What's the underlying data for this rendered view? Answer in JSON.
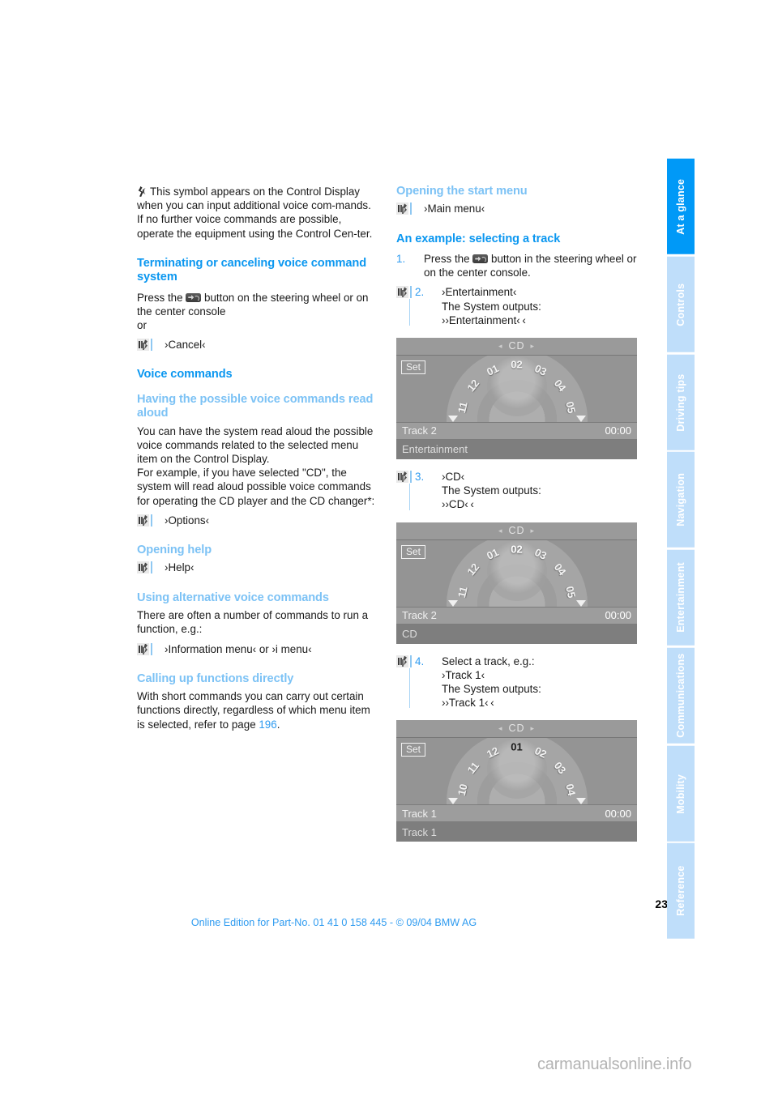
{
  "document": {
    "page_number": "23",
    "footer_text": "Online Edition for Part-No. 01 41 0 158 445 - © 09/04 BMW AG",
    "watermark": "carmanualsonline.info"
  },
  "tabs": [
    {
      "label": "At a glance",
      "active": true
    },
    {
      "label": "Controls",
      "active": false
    },
    {
      "label": "Driving tips",
      "active": false
    },
    {
      "label": "Navigation",
      "active": false
    },
    {
      "label": "Entertainment",
      "active": false
    },
    {
      "label": "Communications",
      "active": false
    },
    {
      "label": "Mobility",
      "active": false
    },
    {
      "label": "Reference",
      "active": false
    }
  ],
  "colors": {
    "heading_blue": "#0b97f0",
    "subheading_blue": "#7cc2f5",
    "tab_active": "#0099f7",
    "tab_inactive": "#bfdefa",
    "link": "#2e9bf0"
  },
  "left_column": {
    "intro_symbol_note": "This symbol appears on the Control Display when you can input additional voice com-mands.",
    "intro_line2": "If no further voice commands are possible, operate the equipment using the Control Cen-ter.",
    "terminating_heading": "Terminating or canceling voice command system",
    "terminating_body_a": "Press the ",
    "terminating_body_b": " button on the steering wheel or on the center console",
    "or_word": "or",
    "cancel_command": "›Cancel‹",
    "voice_commands_heading": "Voice commands",
    "read_aloud_heading": "Having the possible voice commands read aloud",
    "read_aloud_body": "You can have the system read aloud the possible voice commands related to the selected menu item on the Control Display.",
    "read_aloud_body2": "For example, if you have selected \"CD\", the system will read aloud possible voice commands for operating the CD player and the CD changer*:",
    "options_command": "›Options‹",
    "opening_help_heading": "Opening help",
    "help_command": "›Help‹",
    "alternative_heading": "Using alternative voice commands",
    "alternative_body": "There are often a number of commands to run a function, e.g.:",
    "alternative_command": "›Information menu‹  or ›i menu‹",
    "direct_heading": "Calling up functions directly",
    "direct_body_a": "With short commands you can carry out certain functions directly, regardless of which menu item is selected, refer to page ",
    "direct_page_ref": "196",
    "direct_body_b": "."
  },
  "right_column": {
    "start_menu_heading": "Opening the start menu",
    "main_menu_command": "›Main menu‹",
    "example_heading": "An example: selecting a track",
    "steps": [
      {
        "number": "1.",
        "text_a": "Press the ",
        "text_b": " button in the steering wheel or on the center console."
      },
      {
        "number": "2.",
        "command": "›Entertainment‹",
        "outputs_label": "The System outputs:",
        "output": "››Entertainment‹ ‹"
      },
      {
        "number": "3.",
        "command": "›CD‹",
        "outputs_label": "The System outputs:",
        "output": "››CD‹ ‹"
      },
      {
        "number": "4.",
        "lead": "Select a track, e.g.:",
        "command": "›Track 1‹",
        "outputs_label": "The System outputs:",
        "output": "››Track 1‹ ‹"
      }
    ],
    "displays": [
      {
        "title": "CD",
        "set_label": "Set",
        "track_label": "Track 2",
        "time": "00:00",
        "status": "Entertainment",
        "ticks": [
          "11",
          "12",
          "01",
          "02",
          "03",
          "04",
          "05"
        ],
        "selected": null,
        "selected_style": "none"
      },
      {
        "title": "CD",
        "set_label": "Set",
        "track_label": "Track 2",
        "time": "00:00",
        "status": "CD",
        "ticks": [
          "11",
          "12",
          "01",
          "02",
          "03",
          "04",
          "05"
        ],
        "selected": "02",
        "selected_style": "white"
      },
      {
        "title": "CD",
        "set_label": "Set",
        "track_label": "Track 1",
        "time": "00:00",
        "status": "Track 1",
        "ticks": [
          "10",
          "11",
          "12",
          "01",
          "02",
          "03",
          "04"
        ],
        "selected": "01",
        "selected_style": "dark"
      }
    ],
    "nav_arrow_left": "◂",
    "nav_arrow_right": "▸"
  }
}
